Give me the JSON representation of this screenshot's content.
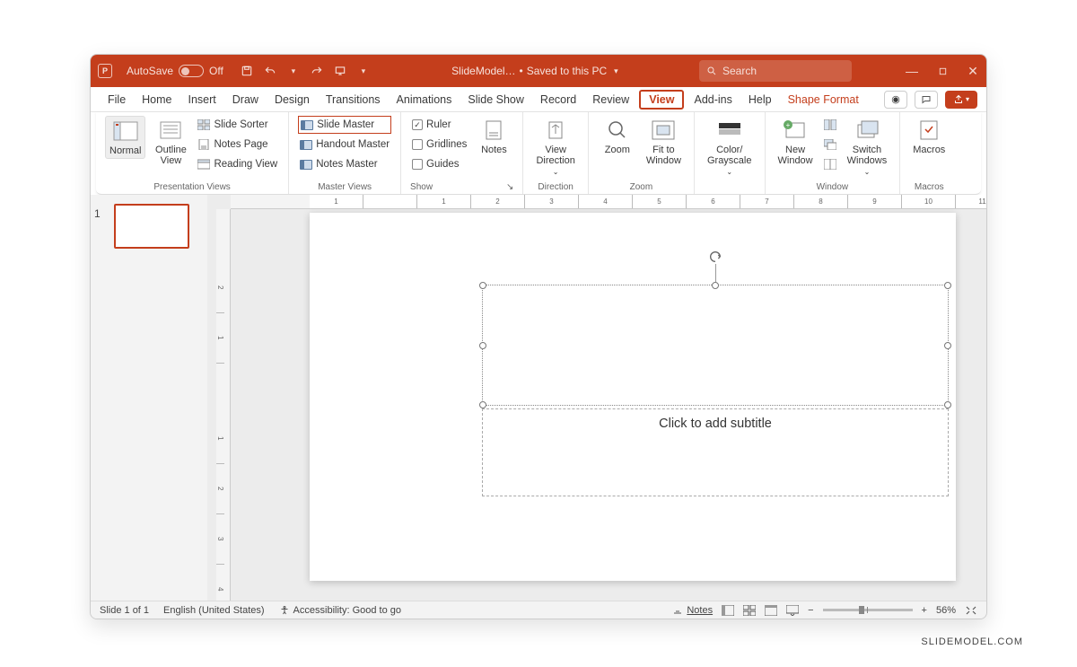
{
  "titlebar": {
    "autosave_label": "AutoSave",
    "autosave_state": "Off",
    "doc_name": "SlideModel…",
    "saved_status": "Saved to this PC",
    "search_placeholder": "Search"
  },
  "tabs": {
    "file": "File",
    "home": "Home",
    "insert": "Insert",
    "draw": "Draw",
    "design": "Design",
    "transitions": "Transitions",
    "animations": "Animations",
    "slideshow": "Slide Show",
    "record": "Record",
    "review": "Review",
    "view": "View",
    "addins": "Add-ins",
    "help": "Help",
    "shapeformat": "Shape Format"
  },
  "ribbon": {
    "groups": {
      "presentation_views": {
        "label": "Presentation Views",
        "normal": "Normal",
        "outline_view": "Outline\nView",
        "slide_sorter": "Slide Sorter",
        "notes_page": "Notes Page",
        "reading_view": "Reading View"
      },
      "master_views": {
        "label": "Master Views",
        "slide_master": "Slide Master",
        "handout_master": "Handout Master",
        "notes_master": "Notes Master"
      },
      "show": {
        "label": "Show",
        "ruler": "Ruler",
        "gridlines": "Gridlines",
        "guides": "Guides",
        "notes": "Notes"
      },
      "direction": {
        "label": "Direction",
        "view_direction": "View\nDirection"
      },
      "zoom": {
        "label": "Zoom",
        "zoom": "Zoom",
        "fit": "Fit to\nWindow"
      },
      "color": {
        "label": "",
        "btn": "Color/\nGrayscale"
      },
      "window": {
        "label": "Window",
        "new_window": "New\nWindow",
        "switch_windows": "Switch\nWindows"
      },
      "macros": {
        "label": "Macros",
        "btn": "Macros"
      }
    }
  },
  "thumbnails": {
    "slide_num": "1"
  },
  "canvas": {
    "subtitle_placeholder": "Click to add subtitle"
  },
  "ruler": {
    "h": [
      "1",
      "",
      "1",
      "2",
      "3",
      "4",
      "5",
      "6",
      "7",
      "8",
      "9",
      "10",
      "11"
    ],
    "v": [
      "",
      "2",
      "1",
      "",
      "1",
      "2",
      "3",
      "4"
    ]
  },
  "statusbar": {
    "slide_pos": "Slide 1 of 1",
    "language": "English (United States)",
    "accessibility": "Accessibility: Good to go",
    "notes": "Notes",
    "zoom": "56%"
  },
  "watermark": "SLIDEMODEL.COM"
}
